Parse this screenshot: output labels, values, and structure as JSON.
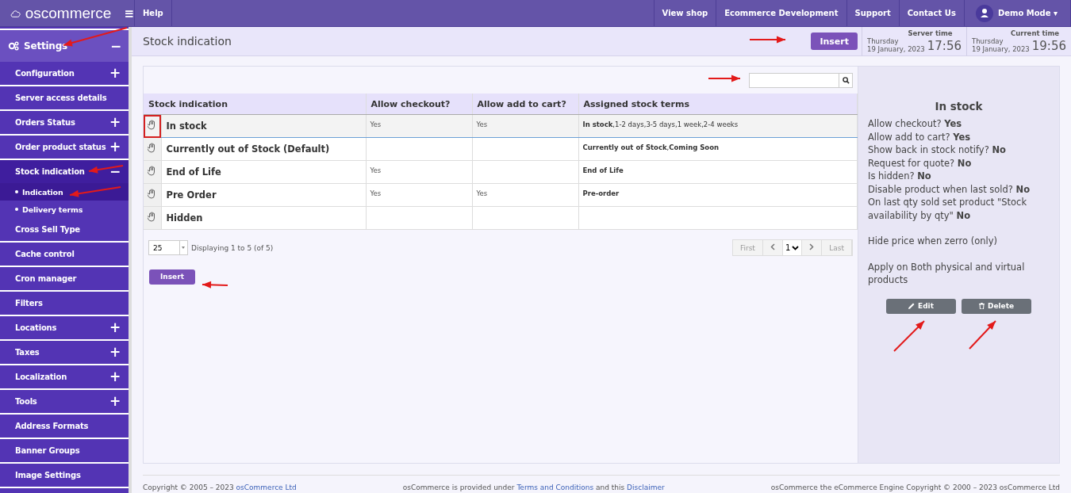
{
  "topbar": {
    "logo": "oscommerce",
    "menu_icon": "≡",
    "help": "Help",
    "links": [
      "View shop",
      "Ecommerce Development",
      "Support",
      "Contact Us"
    ],
    "user": "Demo Mode",
    "user_caret": "▾"
  },
  "sidebar": {
    "section": {
      "label": "Settings",
      "toggle": "−"
    },
    "items": [
      {
        "label": "Configuration",
        "toggle": "+",
        "selected": false
      },
      {
        "label": "Server access details",
        "selected": false
      },
      {
        "label": "Orders Status",
        "toggle": "+",
        "selected": false
      },
      {
        "label": "Order product status",
        "toggle": "+",
        "selected": false
      },
      {
        "label": "Stock indication",
        "toggle": "−",
        "selected": true,
        "children": [
          {
            "label": "Indication",
            "selected": true
          },
          {
            "label": "Delivery terms",
            "selected": false
          }
        ]
      },
      {
        "label": "Cross Sell Type",
        "selected": false
      },
      {
        "label": "Cache control",
        "selected": false
      },
      {
        "label": "Cron manager",
        "selected": false
      },
      {
        "label": "Filters",
        "selected": false
      },
      {
        "label": "Locations",
        "toggle": "+",
        "selected": false
      },
      {
        "label": "Taxes",
        "toggle": "+",
        "selected": false
      },
      {
        "label": "Localization",
        "toggle": "+",
        "selected": false
      },
      {
        "label": "Tools",
        "toggle": "+",
        "selected": false
      },
      {
        "label": "Address Formats",
        "selected": false
      },
      {
        "label": "Banner Groups",
        "selected": false
      },
      {
        "label": "Image Settings",
        "selected": false
      }
    ]
  },
  "page": {
    "title": "Stock indication",
    "insert_button": "Insert",
    "server_time": {
      "label": "Server time",
      "day": "Thursday",
      "date": "19 January, 2023",
      "time": "17:56"
    },
    "current_time": {
      "label": "Current time",
      "day": "Thursday",
      "date": "19 January, 2023",
      "time": "19:56"
    }
  },
  "table": {
    "columns": [
      "Stock indication",
      "Allow checkout?",
      "Allow add to cart?",
      "Assigned stock terms"
    ],
    "rows": [
      {
        "name": "In stock",
        "checkout": "Yes",
        "cart": "Yes",
        "terms": "**In stock**,1-2 days,3-5 days,1 week,2-4 weeks",
        "selected": true,
        "highlighted": true
      },
      {
        "name": "Currently out of Stock (Default)",
        "checkout": "",
        "cart": "",
        "terms": "**Currently out of Stock**,**Coming Soon**",
        "selected": false,
        "highlighted": false
      },
      {
        "name": "End of Life",
        "checkout": "Yes",
        "cart": "",
        "terms": "**End of Life**",
        "selected": false,
        "highlighted": false
      },
      {
        "name": "Pre Order",
        "checkout": "Yes",
        "cart": "Yes",
        "terms": "**Pre-order**",
        "selected": false,
        "highlighted": false
      },
      {
        "name": "Hidden",
        "checkout": "",
        "cart": "",
        "terms": "",
        "selected": false,
        "highlighted": false
      }
    ]
  },
  "pagination": {
    "per_page": "25",
    "info": "Displaying 1 to 5 (of 5)",
    "first": "First",
    "page": "1",
    "last": "Last"
  },
  "insert_button": "Insert",
  "detail": {
    "title": "In stock",
    "groups": [
      [
        "Allow checkout? **Yes**",
        "Allow add to cart? **Yes**",
        "Show back in stock notify? **No**",
        "Request for quote? **No**",
        "Is hidden? **No**",
        "Disable product when last sold? **No**",
        "On last qty sold set product \"Stock availability by qty\" **No**"
      ],
      [
        "Hide price when zerro (only)"
      ],
      [
        "Apply on Both physical and virtual products"
      ]
    ],
    "edit": "Edit",
    "delete": "Delete"
  },
  "footer": {
    "left": "Copyright © 2005 – 2023 ",
    "left_link": "osCommerce Ltd",
    "mid": "osCommerce is provided under ",
    "mid_link1": "Terms and Conditions",
    "mid_and": " and this ",
    "mid_link2": "Disclaimer",
    "right": "osCommerce the eCommerce Engine Copyright © 2000 – 2023 osCommerce Ltd"
  }
}
